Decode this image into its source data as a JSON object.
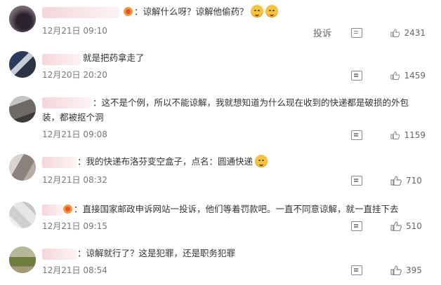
{
  "comments": [
    {
      "text": "：谅解什么呀？谅解他偷药？",
      "time": "12月21日 09:10",
      "likes": "2431",
      "report": "投诉",
      "emoji_count": 2
    },
    {
      "text": "就是把药拿走了",
      "time": "12月20日 20:20",
      "likes": "1459"
    },
    {
      "text": "：这不是个例，所以不能谅解，我就想知道为什么现在收到的快递都是破损的外包装，都被抠个洞",
      "time": "12月21日 09:08",
      "likes": "1159"
    },
    {
      "text": "：我的快递布洛芬变空盒子，点名：圆通快递",
      "time": "12月21日 08:32",
      "likes": "710",
      "emoji_count": 1
    },
    {
      "text": "：直接国家邮政申诉网站一投诉，他们等着罚款吧。一直不同意谅解，就一直挂下去",
      "time": "12月21日 09:15",
      "likes": "510"
    },
    {
      "text": "：谅解就行了？这是犯罪，还是职务犯罪",
      "time": "12月21日 08:54",
      "likes": "395"
    }
  ],
  "icons": {
    "reply": "comment-icon",
    "like": "thumbs-up-icon",
    "emoji": "smiling-emoji-icon",
    "badge": "user-badge-icon"
  },
  "colors": {
    "text": "#333333",
    "meta": "#777777",
    "name_blur": "#f6d6d9"
  }
}
